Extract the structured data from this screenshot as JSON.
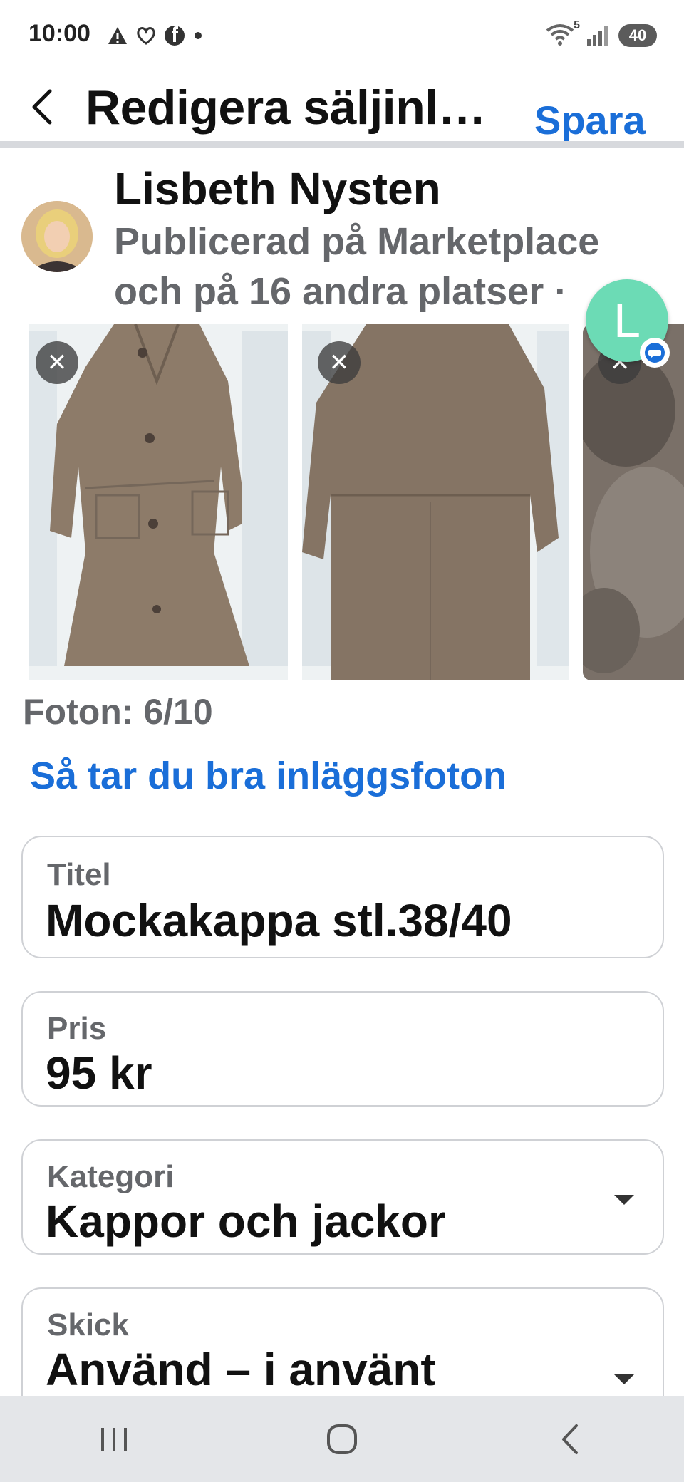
{
  "status_bar": {
    "time": "10:00",
    "icons": [
      "warning-icon",
      "heart-hands-icon",
      "facebook-icon",
      "dot-icon"
    ],
    "right_icons": [
      "wifi-icon",
      "signal-icon"
    ],
    "wifi_badge": "5",
    "battery": "40"
  },
  "header": {
    "title": "Redigera säljinl…",
    "save_label": "Spara"
  },
  "seller": {
    "name": "Lisbeth Nysten",
    "subtitle": "Publicerad på Marketplace och på 16 andra platser ·"
  },
  "chat_head": {
    "letter": "L"
  },
  "photos": {
    "count_text": "Foton: 6/10",
    "tips_link": "Så tar du bra inläggsfoton",
    "remove_symbol": "✕"
  },
  "fields": {
    "title": {
      "label": "Titel",
      "value": "Mockakappa stl.38/40"
    },
    "price": {
      "label": "Pris",
      "value": "95 kr"
    },
    "category": {
      "label": "Kategori",
      "value": "Kappor och jackor"
    },
    "condition": {
      "label": "Skick",
      "value": "Använd – i använt"
    }
  },
  "colors": {
    "accent": "#1a6ed8",
    "secondary_text": "#65676b",
    "chat_green": "#6cdbb5",
    "coat_brown": "#8a7a6a"
  }
}
